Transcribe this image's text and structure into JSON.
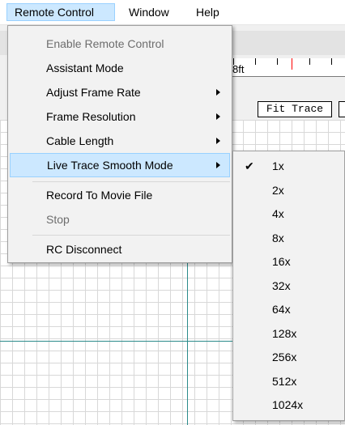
{
  "menubar": {
    "items": [
      {
        "label": "Remote Control"
      },
      {
        "label": "Window"
      },
      {
        "label": "Help"
      }
    ]
  },
  "background": {
    "ruler_label": "8ft",
    "fit_trace_label": "Fit Trace"
  },
  "remote_menu": {
    "items": [
      {
        "label": "Enable Remote Control"
      },
      {
        "label": "Assistant Mode"
      },
      {
        "label": "Adjust Frame Rate"
      },
      {
        "label": "Frame Resolution"
      },
      {
        "label": "Cable Length"
      },
      {
        "label": "Live Trace Smooth Mode"
      },
      {
        "label": "Record To Movie File"
      },
      {
        "label": "Stop"
      },
      {
        "label": "RC Disconnect"
      }
    ]
  },
  "smooth_submenu": {
    "checkmark": "✔",
    "selected": "1x",
    "items": [
      {
        "label": "1x"
      },
      {
        "label": "2x"
      },
      {
        "label": "4x"
      },
      {
        "label": "8x"
      },
      {
        "label": "16x"
      },
      {
        "label": "32x"
      },
      {
        "label": "64x"
      },
      {
        "label": "128x"
      },
      {
        "label": "256x"
      },
      {
        "label": "512x"
      },
      {
        "label": "1024x"
      }
    ]
  }
}
